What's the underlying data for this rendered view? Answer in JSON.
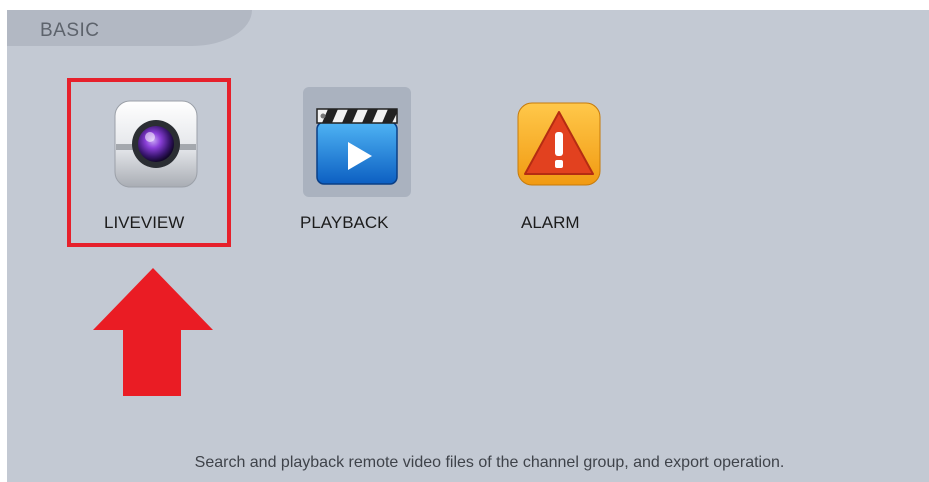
{
  "section": {
    "title": "BASIC"
  },
  "apps": [
    {
      "label": "LIVEVIEW",
      "icon": "camera-icon"
    },
    {
      "label": "PLAYBACK",
      "icon": "video-clapperboard-icon"
    },
    {
      "label": "ALARM",
      "icon": "alarm-warning-icon"
    }
  ],
  "status": {
    "description": "Search and playback remote video files of the channel group, and export operation."
  },
  "annotation": {
    "highlight_color": "#e6202b",
    "arrow_color": "#e6202b",
    "highlighted_app": "LIVEVIEW"
  }
}
